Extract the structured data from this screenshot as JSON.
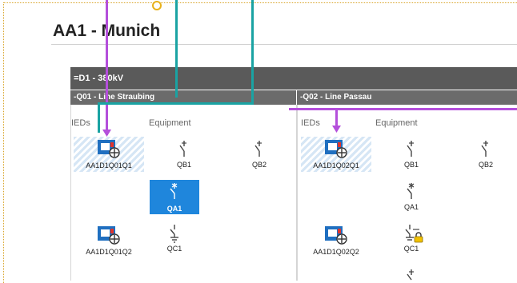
{
  "page": {
    "title": "AA1 - Munich"
  },
  "voltage_level": {
    "label": "=D1 - 380kV"
  },
  "bays": [
    {
      "header": "-Q01 - Line Straubing",
      "ieds_label": "IEDs",
      "equipment_label": "Equipment",
      "ieds": [
        "AA1D1Q01Q1",
        "AA1D1Q01Q2"
      ],
      "equipment": [
        "QB1",
        "QB2",
        "QA1",
        "QC1"
      ]
    },
    {
      "header": "-Q02 - Line Passau",
      "ieds_label": "IEDs",
      "equipment_label": "Equipment",
      "ieds": [
        "AA1D1Q02Q1",
        "AA1D1Q02Q2"
      ],
      "equipment": [
        "QB1",
        "QB2",
        "QA1",
        "QC1"
      ]
    }
  ],
  "colors": {
    "purple_link": "#b44fdb",
    "teal_link": "#1aa3a3",
    "selection": "#1f86dc",
    "anchor": "#e8b21c"
  },
  "icons": [
    "ied-icon",
    "disconnector-icon",
    "circuit-breaker-icon",
    "earthing-switch-icon",
    "lock-icon"
  ]
}
